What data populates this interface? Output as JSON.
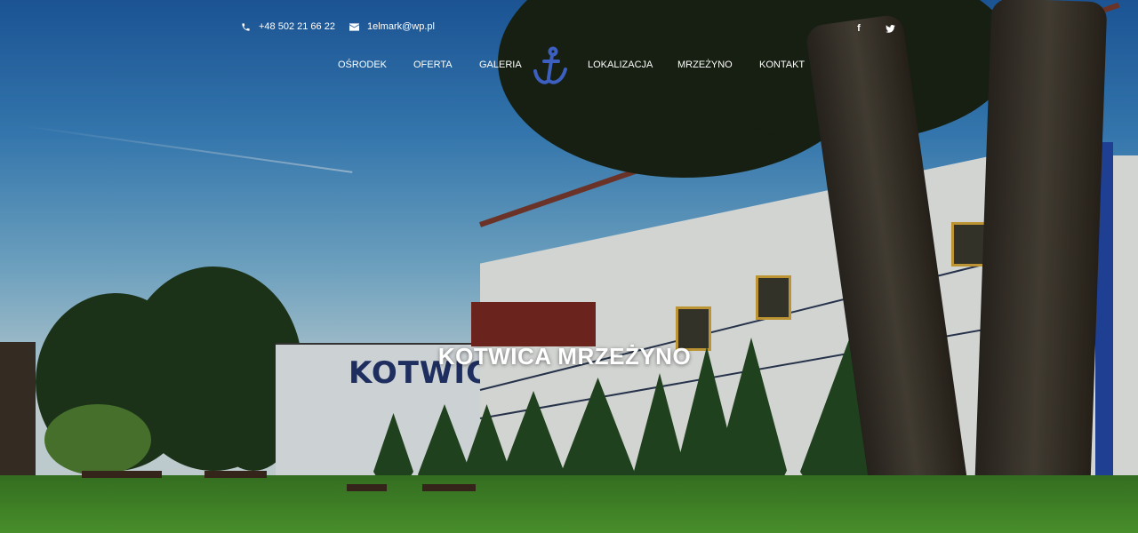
{
  "contact": {
    "phone": "+48 502 21 66 22",
    "email": "1elmark@wp.pl",
    "phone_icon": "phone-icon",
    "email_icon": "envelope-icon"
  },
  "social": [
    {
      "name": "facebook",
      "glyph": "f",
      "icon": "facebook-icon"
    },
    {
      "name": "twitter",
      "glyph": "t",
      "icon": "twitter-icon"
    }
  ],
  "nav": {
    "items": [
      "OŚRODEK",
      "OFERTA",
      "GALERIA",
      "LOKALIZACJA",
      "MRZEŻYNO",
      "KONTAKT"
    ],
    "logo_icon": "anchor-icon"
  },
  "hero": {
    "title": "KOTWICA MRZEŻYNO",
    "building_sign": "KOTWICA"
  },
  "colors": {
    "text": "#ffffff",
    "logo": "#3c5fc0",
    "sky_top": "#1f5fa8"
  }
}
